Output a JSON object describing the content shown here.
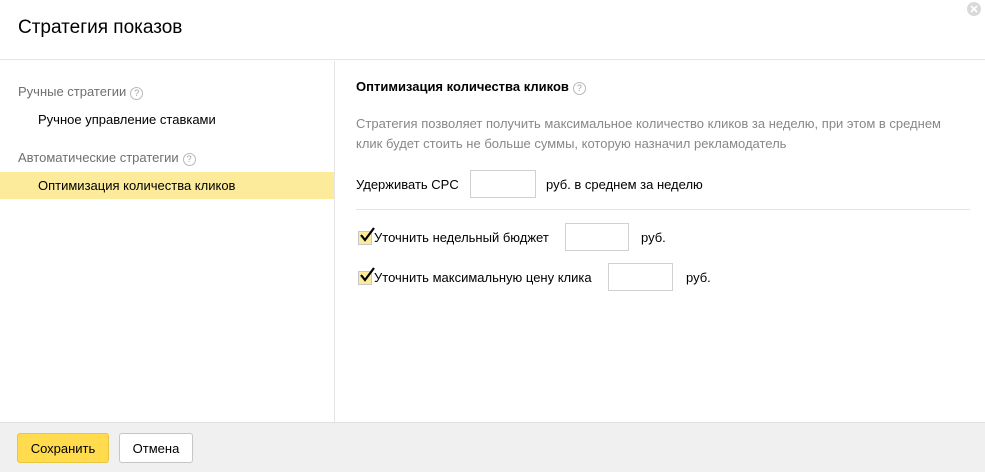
{
  "dialog": {
    "title": "Стратегия показов",
    "close_icon": "close-icon"
  },
  "sidebar": {
    "manual_group": {
      "label": "Ручные стратегии",
      "help": "?"
    },
    "manual_items": [
      {
        "label": "Ручное управление ставками",
        "active": false
      }
    ],
    "auto_group": {
      "label": "Автоматические стратегии",
      "help": "?"
    },
    "auto_items": [
      {
        "label": "Оптимизация количества кликов",
        "active": true
      }
    ]
  },
  "content": {
    "title": "Оптимизация количества кликов",
    "title_help": "?",
    "description": "Стратегия позволяет получить максимальное количество кликов за неделю, при этом в среднем клик будет стоить не больше суммы, которую назначил рекламодатель",
    "cpc": {
      "label": "Удерживать CPC",
      "value": "",
      "suffix": "руб. в среднем за неделю"
    },
    "weekly_budget": {
      "label": "Уточнить недельный бюджет",
      "checked": true,
      "value": "",
      "suffix": "руб."
    },
    "max_click_price": {
      "label": "Уточнить максимальную цену клика",
      "checked": true,
      "value": "",
      "suffix": "руб."
    }
  },
  "footer": {
    "save_label": "Сохранить",
    "cancel_label": "Отмена"
  },
  "colors": {
    "accent_yellow": "#ffdb4d",
    "active_item_bg": "#fdeb9c",
    "muted_text": "#888888"
  }
}
